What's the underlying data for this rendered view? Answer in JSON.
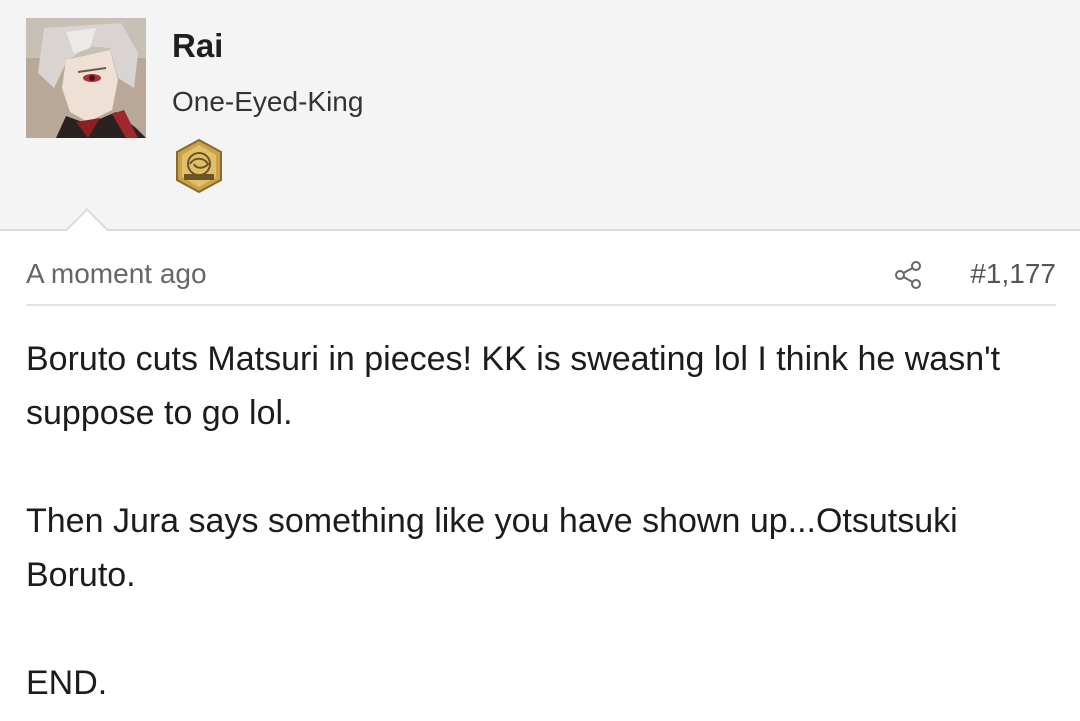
{
  "author": {
    "username": "Rai",
    "title": "One-Eyed-King",
    "badge_icon": "fanverse-hex-badge-icon",
    "badge_colors": {
      "gold": "#c9a24a",
      "dark": "#6b5426"
    }
  },
  "post": {
    "timestamp": "A moment ago",
    "share_icon": "share-icon",
    "number": "#1,177",
    "paragraphs": [
      "Boruto cuts Matsuri in pieces! KK is sweating lol I think he wasn't suppose to go lol.",
      "Then Jura says something like you have shown up...Otsutsuki Boruto.",
      "END."
    ]
  }
}
